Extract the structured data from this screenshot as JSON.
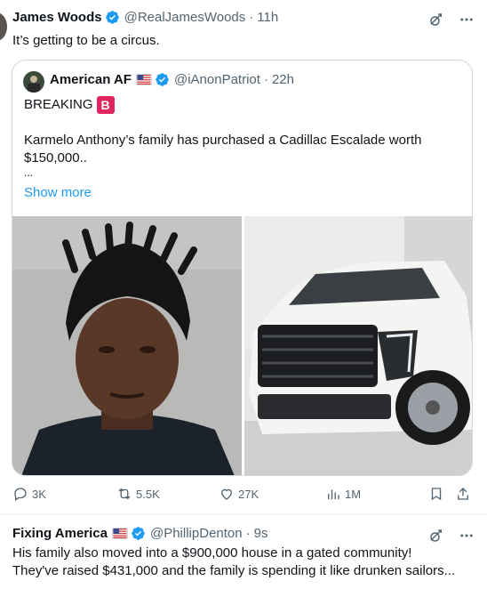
{
  "tweet1": {
    "name": "James Woods",
    "handle": "@RealJamesWoods",
    "dot": "·",
    "time": "11h",
    "text": "It’s getting to be a circus."
  },
  "quote": {
    "name": "American AF",
    "handle": "@iAnonPatriot",
    "dot": "·",
    "time": "22h",
    "line1": "BREAKING",
    "badge": "B",
    "line2": "Karmelo Anthony’s family has purchased a Cadillac Escalade worth",
    "line3": "$150,000..",
    "ellipsis": "...",
    "show_more": "Show more"
  },
  "actions": {
    "replies": "3K",
    "reposts": "5.5K",
    "likes": "27K",
    "views": "1M"
  },
  "tweet2": {
    "name": "Fixing America",
    "handle": "@PhillipDenton",
    "dot": "·",
    "time": "9s",
    "line1": "His family also moved into a $900,000 house in a gated community!",
    "line2": "They've raised $431,000 and the family is spending it like drunken sailors..."
  },
  "colors": {
    "accent": "#1d9bf0",
    "text": "#0f1419",
    "secondary": "#536471",
    "badge": "#e0245e"
  }
}
